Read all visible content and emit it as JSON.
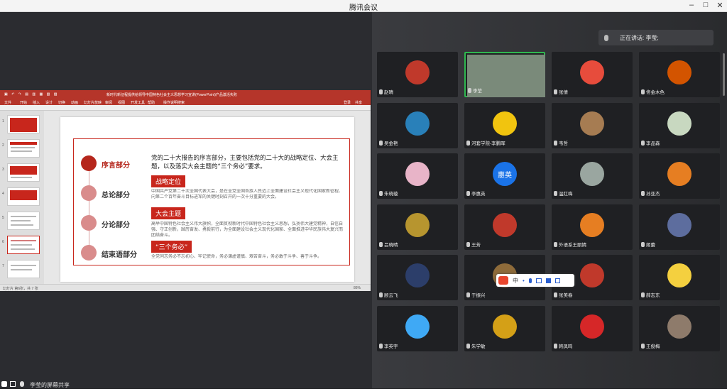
{
  "window": {
    "title": "腾讯会议"
  },
  "speaking": {
    "label": "正在讲话: 李莹;"
  },
  "ppt": {
    "filename": "新时代新征程提供给领导中国特色社会主义思想学习宣讲(PowerPoint)产品激活失败",
    "menus": [
      "文件",
      "开始",
      "插入",
      "设计",
      "切换",
      "动画",
      "幻灯片放映",
      "审阅",
      "视图",
      "开发工具",
      "帮助",
      "操作说明搜索"
    ],
    "login": "登录",
    "share": "共享",
    "status_left": "幻灯片 第6张，共 7 张",
    "status_zoom": "86%",
    "slide": {
      "intro": "党的二十大报告的序言部分，主要包括党的二十大的战略定位、大会主题，以及落实大会主题的“三个务必”要求。",
      "sections": [
        "序言部分",
        "总论部分",
        "分论部分",
        "结束语部分"
      ],
      "tags": [
        "战略定位",
        "大会主题",
        "“三个务必”"
      ],
      "paras": [
        "中国共产党第二十次全国代表大会，是在全党全国各族人民迈上全面建设社会主义现代化国家新征程、向第二个百年奋斗目标进军的关键时刻召开的一次十分重要的大会。",
        "高举中国特色社会主义伟大旗帜，全面贯彻新时代中国特色社会主义思想，弘扬伟大建党精神，自信自强、守正创新，踔厉奋发、勇毅前行，为全面建设社会主义现代化国家、全面推进中华民族伟大复兴而团结奋斗。",
        "全党同志务必不忘初心、牢记使命，务必谦虚谨慎、艰苦奋斗，务必敢于斗争、善于斗争。"
      ]
    }
  },
  "share_bar": {
    "label": "李莹的屏幕共享"
  },
  "participants": [
    {
      "name": "赵晴",
      "color": "#c0392b"
    },
    {
      "name": "李莹",
      "color": "#7a8a7a"
    },
    {
      "name": "张倩",
      "color": "#e74c3c"
    },
    {
      "name": "佟金木色",
      "color": "#d35400"
    },
    {
      "name": "吴金艳",
      "color": "#2980b9"
    },
    {
      "name": "河套学院-李鹏晖",
      "color": "#f1c40f"
    },
    {
      "name": "韦哲",
      "color": "#a67c52"
    },
    {
      "name": "李品森",
      "color": "#c8d8c0"
    },
    {
      "name": "朱晓璇",
      "color": "#e8b4c8"
    },
    {
      "name": "李惠英",
      "color": "#1a73e8",
      "text": "惠英"
    },
    {
      "name": "温红梅",
      "color": "#9aa6a0"
    },
    {
      "name": "孙亚杰",
      "color": "#e67e22"
    },
    {
      "name": "吕晓晴",
      "color": "#b7952f"
    },
    {
      "name": "王芳",
      "color": "#c0392b"
    },
    {
      "name": "外语系王丽婧",
      "color": "#e67e22"
    },
    {
      "name": "姬蕾",
      "color": "#5d6d9e"
    },
    {
      "name": "顾云飞",
      "color": "#2c3e6a"
    },
    {
      "name": "于振兴",
      "color": "#8e6b3a"
    },
    {
      "name": "张美春",
      "color": "#c0392b"
    },
    {
      "name": "薛志东",
      "color": "#f4d03f"
    },
    {
      "name": "李英宇",
      "color": "#3fa9f5"
    },
    {
      "name": "朱学敏",
      "color": "#d4a017"
    },
    {
      "name": "韩凤鸣",
      "color": "#d62728"
    },
    {
      "name": "王俊梅",
      "color": "#8e7b6b"
    }
  ],
  "ime": {
    "label": "中"
  }
}
